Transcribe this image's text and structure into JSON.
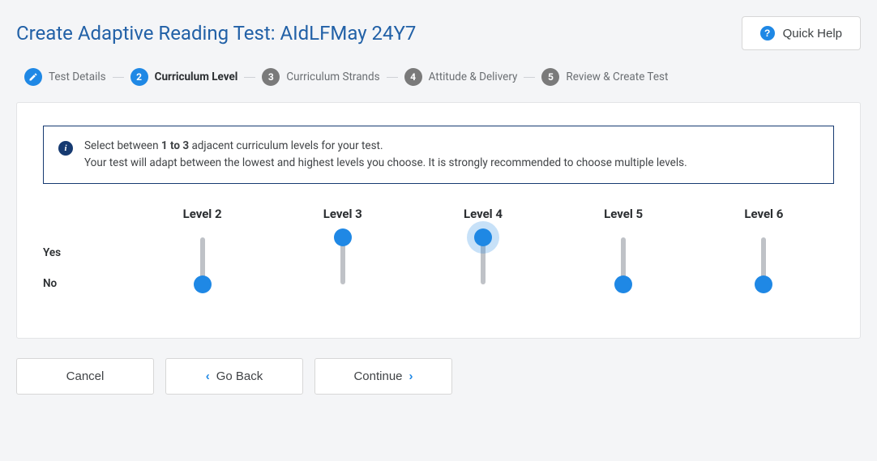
{
  "header": {
    "title": "Create Adaptive Reading Test: AIdLFMay 24Y7",
    "quick_help_label": "Quick Help"
  },
  "stepper": {
    "steps": [
      {
        "num": "✎",
        "label": "Test Details",
        "state": "completed"
      },
      {
        "num": "2",
        "label": "Curriculum Level",
        "state": "active"
      },
      {
        "num": "3",
        "label": "Curriculum Strands",
        "state": "pending"
      },
      {
        "num": "4",
        "label": "Attitude & Delivery",
        "state": "pending"
      },
      {
        "num": "5",
        "label": "Review & Create Test",
        "state": "pending"
      }
    ]
  },
  "info": {
    "line1_pre": "Select between ",
    "line1_bold": "1 to 3",
    "line1_post": " adjacent curriculum levels for your test.",
    "line2": "Your test will adapt between the lowest and highest levels you choose. It is strongly recommended to choose multiple levels."
  },
  "levels": {
    "yes_label": "Yes",
    "no_label": "No",
    "columns": [
      {
        "label": "Level 2",
        "value": "no",
        "glow": false
      },
      {
        "label": "Level 3",
        "value": "yes",
        "glow": false
      },
      {
        "label": "Level 4",
        "value": "yes",
        "glow": true
      },
      {
        "label": "Level 5",
        "value": "no",
        "glow": false
      },
      {
        "label": "Level 6",
        "value": "no",
        "glow": false
      }
    ]
  },
  "footer": {
    "cancel": "Cancel",
    "go_back": "Go Back",
    "continue": "Continue"
  }
}
